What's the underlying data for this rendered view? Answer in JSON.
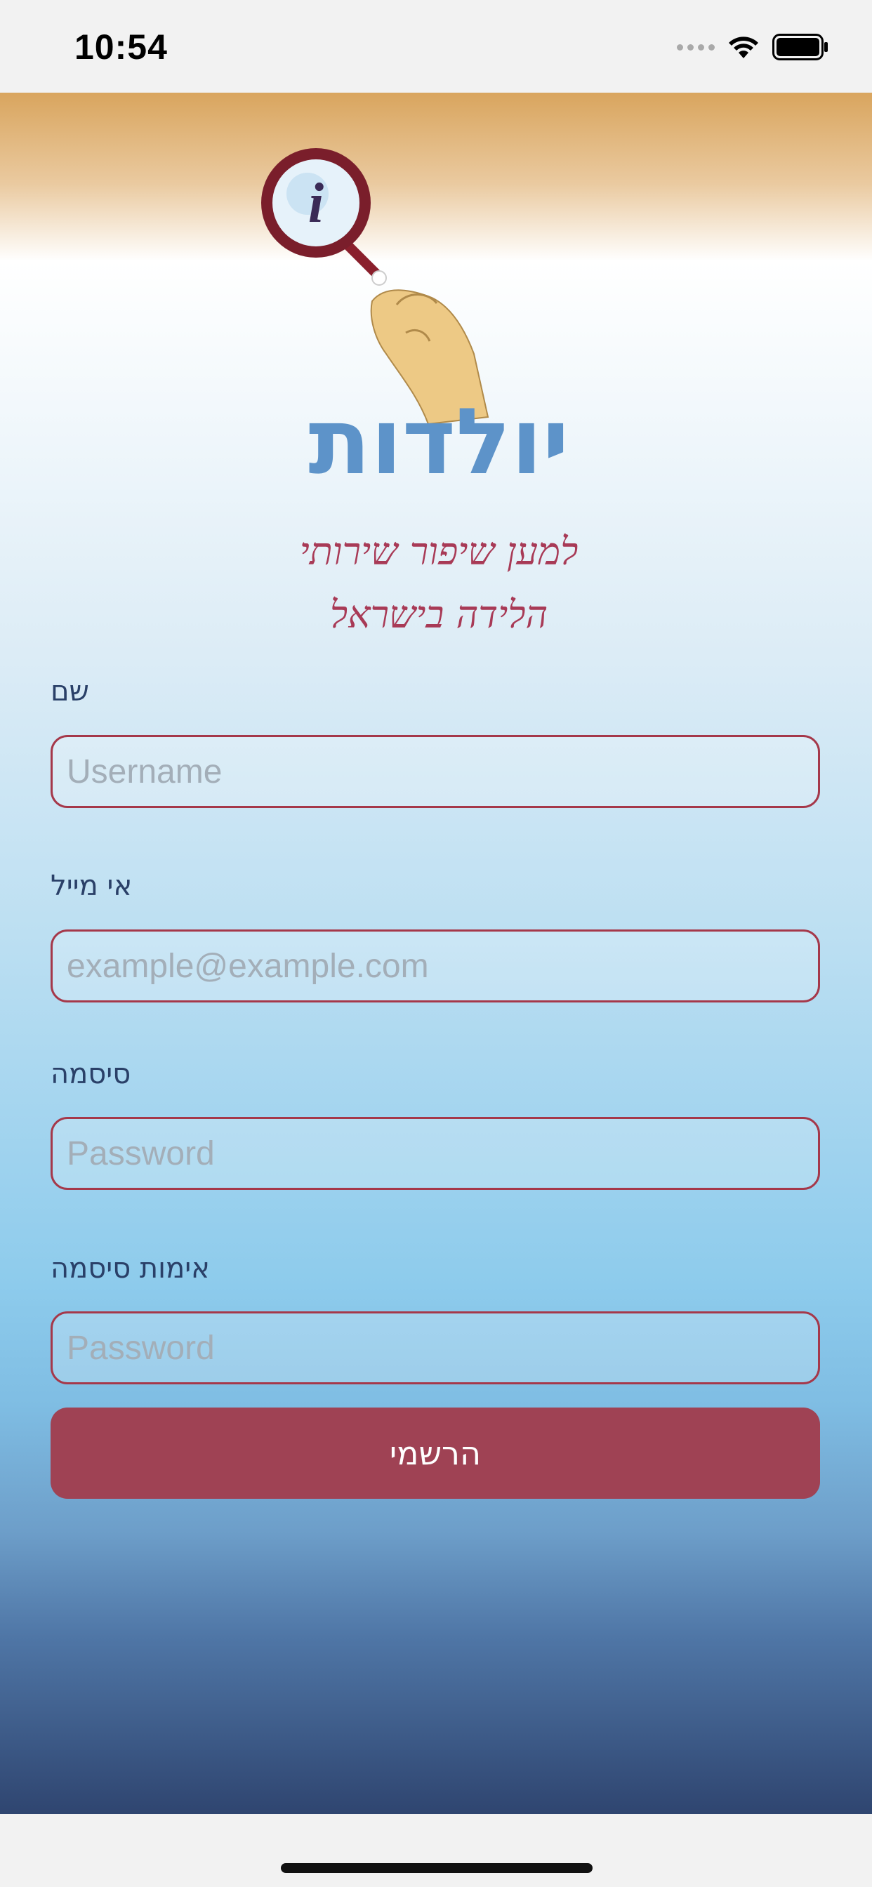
{
  "status_bar": {
    "time": "10:54",
    "icons": [
      "signal-dots-icon",
      "wifi-icon",
      "battery-icon"
    ]
  },
  "logo": {
    "letter": "i",
    "title": "יולדות",
    "tagline_line1": "למען שיפור שירותי",
    "tagline_line2": "הלידה בישראל"
  },
  "form": {
    "name_label": "שם",
    "name_placeholder": "Username",
    "email_label": "אי מייל",
    "email_placeholder": "example@example.com",
    "password_label": "סיסמה",
    "password_placeholder": "Password",
    "confirm_label": "אימות סיסמה",
    "confirm_placeholder": "Password",
    "register_label": "הרשמי"
  },
  "colors": {
    "accent": "#9f4254",
    "label": "#2a4068",
    "gradient_top": "#d9a55e",
    "gradient_bottom": "#2f4570"
  }
}
